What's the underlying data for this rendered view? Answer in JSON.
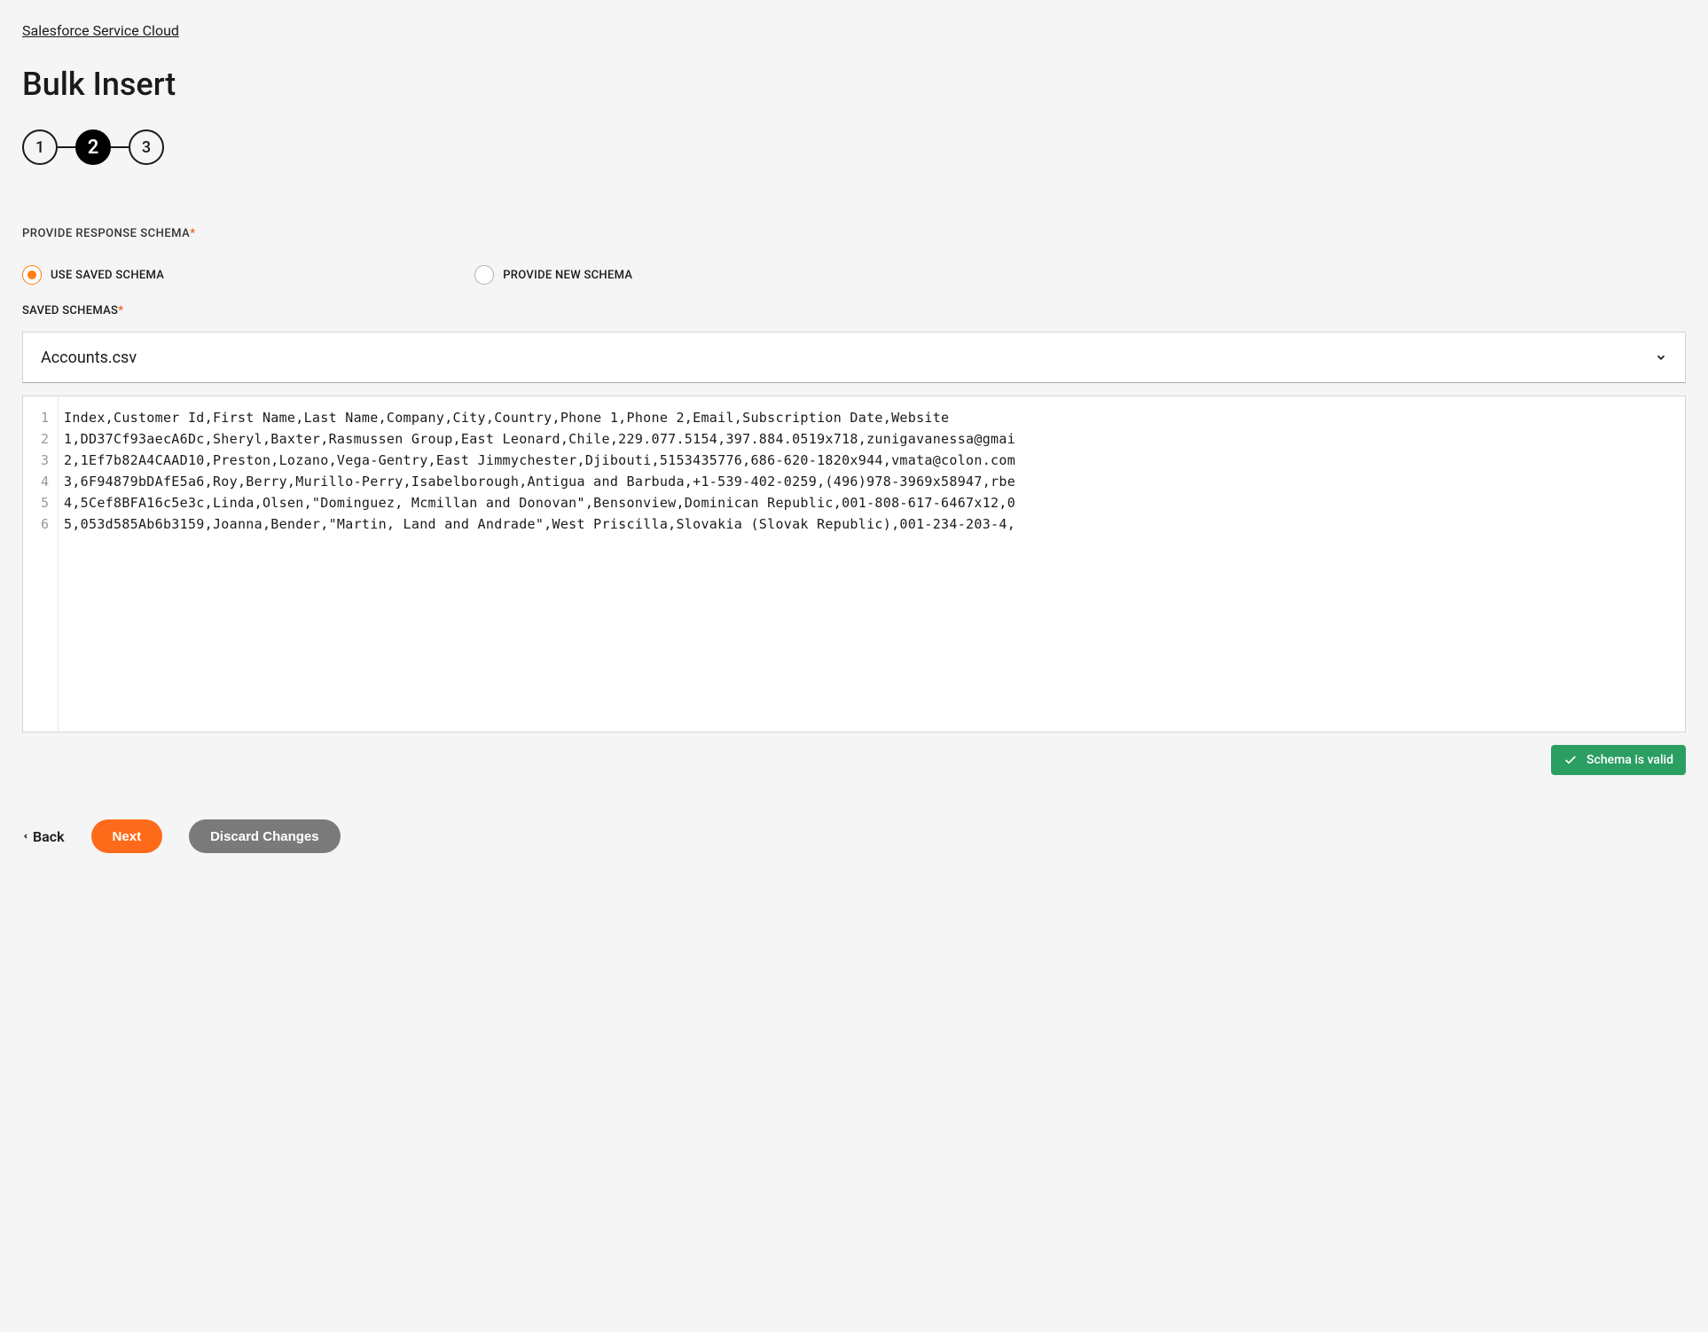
{
  "breadcrumb": "Salesforce Service Cloud",
  "page_title": "Bulk Insert",
  "stepper": {
    "steps": [
      "1",
      "2",
      "3"
    ],
    "active_index": 1
  },
  "section": {
    "label": "PROVIDE RESPONSE SCHEMA"
  },
  "radio": {
    "use_saved": "USE SAVED SCHEMA",
    "provide_new": "PROVIDE NEW SCHEMA",
    "selected": "use_saved"
  },
  "saved_schemas": {
    "label": "SAVED SCHEMAS",
    "selected_value": "Accounts.csv"
  },
  "editor": {
    "lines": [
      "Index,Customer Id,First Name,Last Name,Company,City,Country,Phone 1,Phone 2,Email,Subscription Date,Website",
      "1,DD37Cf93aecA6Dc,Sheryl,Baxter,Rasmussen Group,East Leonard,Chile,229.077.5154,397.884.0519x718,zunigavanessa@gmai",
      "2,1Ef7b82A4CAAD10,Preston,Lozano,Vega-Gentry,East Jimmychester,Djibouti,5153435776,686-620-1820x944,vmata@colon.com",
      "3,6F94879bDAfE5a6,Roy,Berry,Murillo-Perry,Isabelborough,Antigua and Barbuda,+1-539-402-0259,(496)978-3969x58947,rbe",
      "4,5Cef8BFA16c5e3c,Linda,Olsen,\"Dominguez, Mcmillan and Donovan\",Bensonview,Dominican Republic,001-808-617-6467x12,0",
      "5,053d585Ab6b3159,Joanna,Bender,\"Martin, Land and Andrade\",West Priscilla,Slovakia (Slovak Republic),001-234-203-4,"
    ]
  },
  "validation": {
    "valid_label": "Schema is valid"
  },
  "actions": {
    "back": "Back",
    "next": "Next",
    "discard": "Discard Changes"
  }
}
